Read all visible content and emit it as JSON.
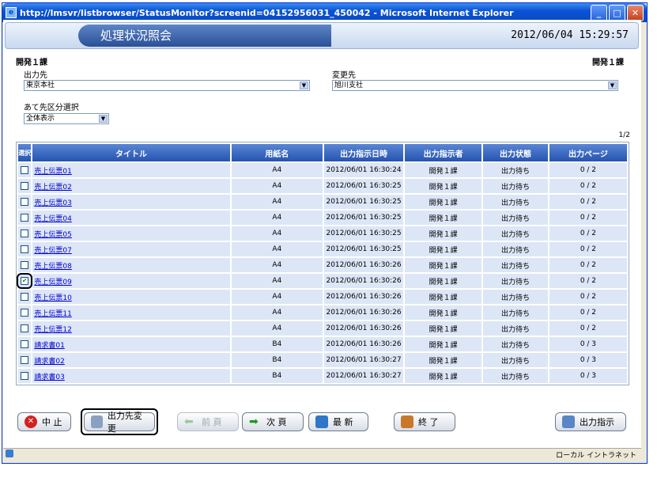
{
  "window": {
    "title": "http://lmsvr/listbrowser/StatusMonitor?screenid=04152956031_450042 - Microsoft Internet Explorer"
  },
  "header": {
    "title": "処理状況照会",
    "datetime": "2012/06/04  15:29:57"
  },
  "dept_left": "開発１課",
  "dept_right": "開発１課",
  "output_dest": {
    "label": "出力先",
    "value": "東京本社"
  },
  "change_dest": {
    "label": "変更先",
    "value": "旭川支社"
  },
  "filter": {
    "label": "あて先区分選択",
    "value": "全体表示"
  },
  "page_indicator": "1/2",
  "table": {
    "headers": [
      "選択",
      "タイトル",
      "用紙名",
      "出力指示日時",
      "出力指示者",
      "出力状態",
      "出力ページ"
    ],
    "rows": [
      {
        "checked": false,
        "title": "売上伝票01",
        "paper": "A4",
        "datetime": "2012/06/01 16:30:24",
        "by": "開発１課",
        "state": "出力待ち",
        "pages": "0 / 2"
      },
      {
        "checked": false,
        "title": "売上伝票02",
        "paper": "A4",
        "datetime": "2012/06/01 16:30:25",
        "by": "開発１課",
        "state": "出力待ち",
        "pages": "0 / 2"
      },
      {
        "checked": false,
        "title": "売上伝票03",
        "paper": "A4",
        "datetime": "2012/06/01 16:30:25",
        "by": "開発１課",
        "state": "出力待ち",
        "pages": "0 / 2"
      },
      {
        "checked": false,
        "title": "売上伝票04",
        "paper": "A4",
        "datetime": "2012/06/01 16:30:25",
        "by": "開発１課",
        "state": "出力待ち",
        "pages": "0 / 2"
      },
      {
        "checked": false,
        "title": "売上伝票05",
        "paper": "A4",
        "datetime": "2012/06/01 16:30:25",
        "by": "開発１課",
        "state": "出力待ち",
        "pages": "0 / 2"
      },
      {
        "checked": false,
        "title": "売上伝票07",
        "paper": "A4",
        "datetime": "2012/06/01 16:30:25",
        "by": "開発１課",
        "state": "出力待ち",
        "pages": "0 / 2"
      },
      {
        "checked": false,
        "title": "売上伝票08",
        "paper": "A4",
        "datetime": "2012/06/01 16:30:26",
        "by": "開発１課",
        "state": "出力待ち",
        "pages": "0 / 2"
      },
      {
        "checked": true,
        "title": "売上伝票09",
        "paper": "A4",
        "datetime": "2012/06/01 16:30:26",
        "by": "開発１課",
        "state": "出力待ち",
        "pages": "0 / 2"
      },
      {
        "checked": false,
        "title": "売上伝票10",
        "paper": "A4",
        "datetime": "2012/06/01 16:30:26",
        "by": "開発１課",
        "state": "出力待ち",
        "pages": "0 / 2"
      },
      {
        "checked": false,
        "title": "売上伝票11",
        "paper": "A4",
        "datetime": "2012/06/01 16:30:26",
        "by": "開発１課",
        "state": "出力待ち",
        "pages": "0 / 2"
      },
      {
        "checked": false,
        "title": "売上伝票12",
        "paper": "A4",
        "datetime": "2012/06/01 16:30:26",
        "by": "開発１課",
        "state": "出力待ち",
        "pages": "0 / 2"
      },
      {
        "checked": false,
        "title": "請求書01",
        "paper": "B4",
        "datetime": "2012/06/01 16:30:26",
        "by": "開発１課",
        "state": "出力待ち",
        "pages": "0 / 3"
      },
      {
        "checked": false,
        "title": "請求書02",
        "paper": "B4",
        "datetime": "2012/06/01 16:30:27",
        "by": "開発１課",
        "state": "出力待ち",
        "pages": "0 / 3"
      },
      {
        "checked": false,
        "title": "請求書03",
        "paper": "B4",
        "datetime": "2012/06/01 16:30:27",
        "by": "開発１課",
        "state": "出力待ち",
        "pages": "0 / 3"
      }
    ]
  },
  "buttons": {
    "stop": "中 止",
    "change_dest": "出力先変更",
    "prev": "前 頁",
    "next": "次 頁",
    "refresh": "最 新",
    "exit": "終 了",
    "output": "出力指示"
  },
  "statusbar": {
    "zone": "ローカル イントラネット"
  }
}
